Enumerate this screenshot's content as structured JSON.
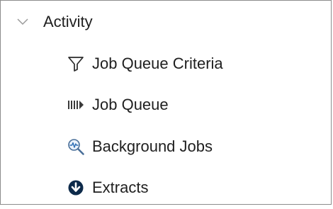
{
  "group": {
    "label": "Activity",
    "chevron_icon": "chevron-down-icon",
    "expanded": true
  },
  "items": [
    {
      "label": "Job Queue Criteria",
      "icon": "filter-icon"
    },
    {
      "label": "Job Queue",
      "icon": "queue-icon"
    },
    {
      "label": "Background Jobs",
      "icon": "magnifier-pulse-icon"
    },
    {
      "label": "Extracts",
      "icon": "download-circle-icon"
    }
  ],
  "colors": {
    "text": "#1f1f1f",
    "icon": "#2b2b2b",
    "border": "#8c8c8c",
    "chevron": "#9a9a9a",
    "accent_blue": "#2f6fb5",
    "dark_icon": "#0d2a4a"
  }
}
